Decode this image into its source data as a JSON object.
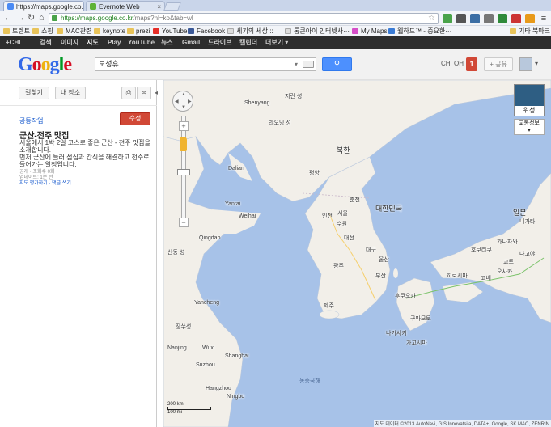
{
  "browser": {
    "tabs": [
      {
        "title": "https://maps.google.co.kr",
        "active": true
      },
      {
        "title": "Evernote Web",
        "active": false
      }
    ],
    "url_host": "https://maps.google.co.kr",
    "url_rest": "/maps?hl=ko&tab=wl",
    "bookmarks": [
      "토렌트",
      "쇼핑",
      "MAC관련",
      "keynote",
      "prezi",
      "YouTube",
      "Facebook",
      "세기의 세상 ::",
      "통큰아이 인터넷사···",
      "My Maps",
      "웹하드™ - 중요한···"
    ],
    "other_bookmarks": "기타 북마크"
  },
  "google_bar": [
    "+CHI",
    "검색",
    "이미지",
    "지도",
    "Play",
    "YouTube",
    "뉴스",
    "Gmail",
    "드라이브",
    "캘린더",
    "더보기 ▾"
  ],
  "header": {
    "logo": [
      "G",
      "o",
      "o",
      "g",
      "l",
      "e"
    ],
    "search_value": "보성휴",
    "user": "CHI OH",
    "notifications": "1",
    "share": "+ 공유"
  },
  "panel": {
    "btn_directions": "길찾기",
    "btn_my_places": "내 장소",
    "collab_link": "공동작업",
    "save_button": "수정",
    "title": "군산-전주 맛집",
    "description_1": "서울에서 1박 2일 코스로 좋은 군산 - 전주 맛집을 소개합니다.",
    "description_2": "먼저 군산에 들러 점심과 간식을 해결하고 전주로 들어가는 일정입니다.",
    "meta_1": "공개 · 조회수 0회",
    "meta_2": "업데이트: 1분 전",
    "rate_link": "지도 평가하기",
    "comment_link": "댓글 쓰기"
  },
  "map": {
    "labels": {
      "bukhan": "북한",
      "daehanminguk": "대한민국",
      "ilbon": "일본",
      "pyeongyang": "평양",
      "seoul": "서울",
      "daejeon": "대전",
      "daegu": "대구",
      "busan": "부산",
      "gwangju": "광주",
      "ulsan": "울산",
      "incheon": "인천",
      "suwon": "수원",
      "chuncheon": "춘천",
      "jeju": "제주",
      "shenyang": "Shenyang",
      "dalian": "Dalian",
      "qingdao": "Qingdao",
      "weihai": "Weihai",
      "yantai": "Yantai",
      "shanghai": "Shanghai",
      "suzhou": "Suzhou",
      "hangzhou": "Hangzhou",
      "ningbo": "Ningbo",
      "nanjing": "Nanjing",
      "wuxi": "Wuxi",
      "yancheng": "Yancheng",
      "fukuoka": "후쿠오카",
      "hiroshima": "히로시마",
      "osaka": "오사카",
      "kyoto": "교토",
      "nagoya": "나고야",
      "nagasaki": "나가사키",
      "kumamoto": "구마모토",
      "kagoshima": "가고시마",
      "kanazawa": "가나자와",
      "niigata": "니가타",
      "kobe": "고베",
      "liaoning": "랴오닝 성",
      "jilin": "지린 성",
      "shandong": "산동 성",
      "jiangsu": "장쑤성",
      "dongjung": "동중국해",
      "hokuriku": "호쿠리쿠"
    },
    "controls": {
      "satellite": "위성",
      "traffic": "교통정보",
      "scale_km": "200 km",
      "scale_mi": "100 mi",
      "attribution": "지도 데이터 ©2013 AutoNavi, GIS Innovatsiia, DATA+, Google, SK M&C, ZENRIN"
    },
    "colors": {
      "land": "#f2efe9",
      "water": "#a7c2e8",
      "korea_north": "#eeede6",
      "korea_south": "#f2f0e6"
    }
  }
}
